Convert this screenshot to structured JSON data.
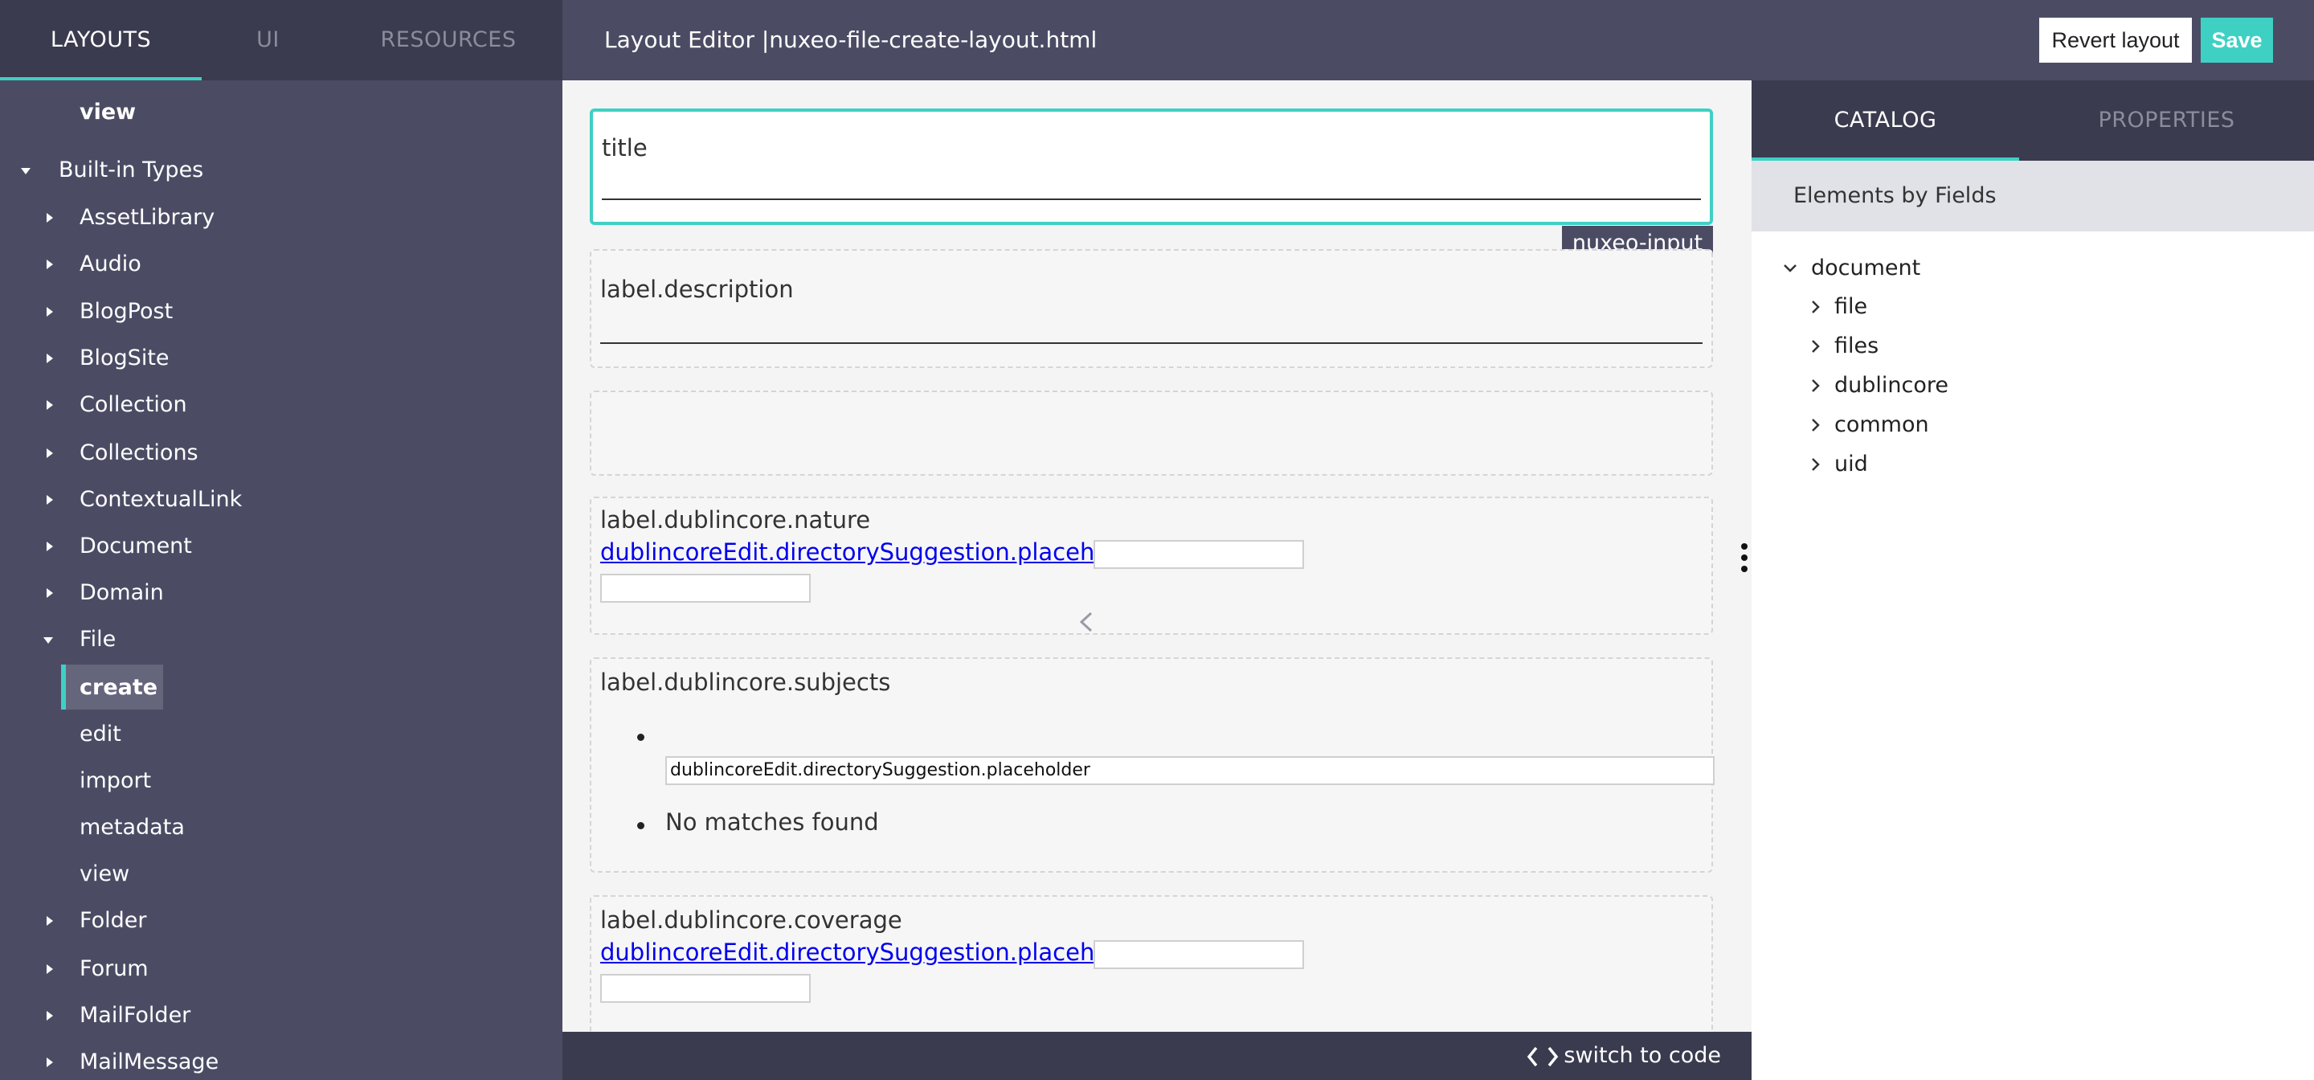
{
  "sidebar": {
    "tabs": [
      {
        "label": "LAYOUTS",
        "active": true
      },
      {
        "label": "UI",
        "active": false
      },
      {
        "label": "RESOURCES",
        "active": false
      }
    ],
    "tree": [
      {
        "label": "view",
        "level": 2,
        "caret": "none",
        "bold": true
      },
      {
        "label": "Built-in Types",
        "level": 0,
        "caret": "down"
      },
      {
        "label": "AssetLibrary",
        "level": 1,
        "caret": "right"
      },
      {
        "label": "Audio",
        "level": 1,
        "caret": "right"
      },
      {
        "label": "BlogPost",
        "level": 1,
        "caret": "right"
      },
      {
        "label": "BlogSite",
        "level": 1,
        "caret": "right"
      },
      {
        "label": "Collection",
        "level": 1,
        "caret": "right"
      },
      {
        "label": "Collections",
        "level": 1,
        "caret": "right"
      },
      {
        "label": "ContextualLink",
        "level": 1,
        "caret": "right"
      },
      {
        "label": "Document",
        "level": 1,
        "caret": "right"
      },
      {
        "label": "Domain",
        "level": 1,
        "caret": "right"
      },
      {
        "label": "File",
        "level": 1,
        "caret": "down"
      },
      {
        "label": "create",
        "level": 2,
        "caret": "none",
        "bold": true,
        "selected": true
      },
      {
        "label": "edit",
        "level": 2,
        "caret": "none"
      },
      {
        "label": "import",
        "level": 2,
        "caret": "none"
      },
      {
        "label": "metadata",
        "level": 2,
        "caret": "none"
      },
      {
        "label": "view",
        "level": 2,
        "caret": "none"
      },
      {
        "label": "Folder",
        "level": 1,
        "caret": "right"
      },
      {
        "label": "Forum",
        "level": 1,
        "caret": "right"
      },
      {
        "label": "MailFolder",
        "level": 1,
        "caret": "right"
      },
      {
        "label": "MailMessage",
        "level": 1,
        "caret": "right"
      }
    ]
  },
  "header": {
    "title": "Layout Editor |nuxeo-file-create-layout.html",
    "revert_label": "Revert layout",
    "save_label": "Save"
  },
  "canvas": {
    "tag_chip": "nuxeo-input",
    "title_field": {
      "label": "title"
    },
    "description_field": {
      "label": "label.description"
    },
    "nature_field": {
      "label": "label.dublincore.nature",
      "link": "dublincoreEdit.directorySuggestion.placeholder"
    },
    "subjects_field": {
      "label": "label.dublincore.subjects",
      "input_placeholder": "dublincoreEdit.directorySuggestion.placeholder",
      "no_matches": "No matches found"
    },
    "coverage_field": {
      "label": "label.dublincore.coverage",
      "link": "dublincoreEdit.directorySuggestion.placeholder"
    }
  },
  "bottombar": {
    "switch_label": "switch to code"
  },
  "rightpanel": {
    "tabs": [
      {
        "label": "CATALOG",
        "active": true
      },
      {
        "label": "PROPERTIES",
        "active": false
      }
    ],
    "section_header": "Elements by Fields",
    "tree": [
      {
        "label": "document",
        "level": 0,
        "expanded": true
      },
      {
        "label": "file",
        "level": 1,
        "expanded": false
      },
      {
        "label": "files",
        "level": 1,
        "expanded": false
      },
      {
        "label": "dublincore",
        "level": 1,
        "expanded": false
      },
      {
        "label": "common",
        "level": 1,
        "expanded": false
      },
      {
        "label": "uid",
        "level": 1,
        "expanded": false
      }
    ]
  },
  "colors": {
    "accent": "#3fd0c4",
    "sidebar_bg": "#4b4c64",
    "tabbar_bg": "#3a3b4f"
  }
}
